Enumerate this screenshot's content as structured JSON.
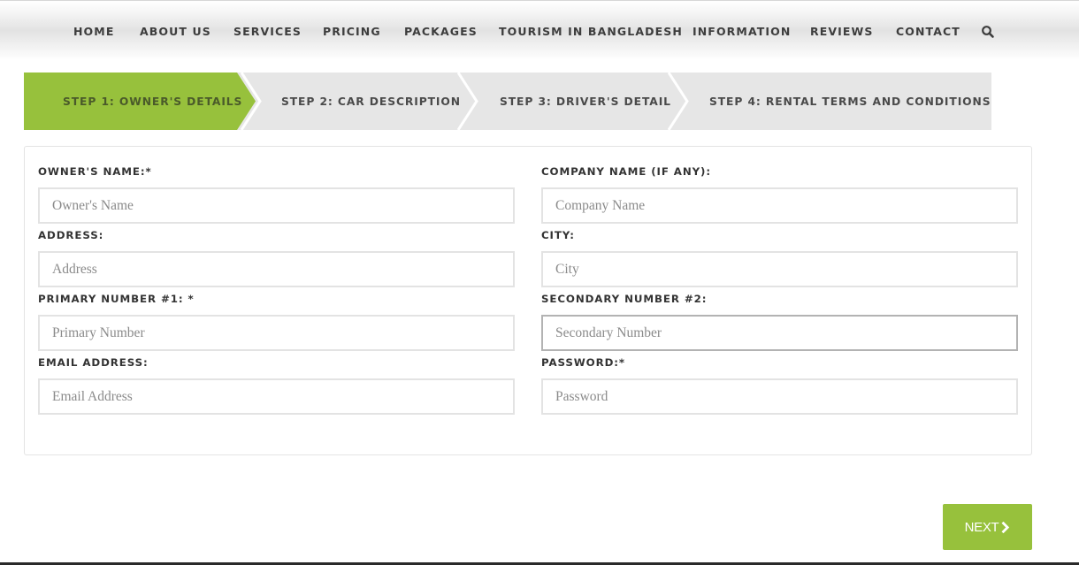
{
  "nav": {
    "items": [
      {
        "label": "HOME"
      },
      {
        "label": "ABOUT US"
      },
      {
        "label": "SERVICES"
      },
      {
        "label": "PRICING"
      },
      {
        "label": "PACKAGES"
      },
      {
        "label": "TOURISM IN BANGLADESH"
      },
      {
        "label": "INFORMATION"
      },
      {
        "label": "REVIEWS"
      },
      {
        "label": "CONTACT"
      }
    ],
    "search_icon": "search-icon"
  },
  "steps": {
    "active_index": 0,
    "active_color": "#97c13c",
    "inactive_color": "#e6e6e6",
    "items": [
      {
        "label": "STEP 1: OWNER'S DETAILS"
      },
      {
        "label": "STEP 2: CAR DESCRIPTION"
      },
      {
        "label": "STEP 3: DRIVER'S DETAIL"
      },
      {
        "label": "STEP 4: RENTAL TERMS AND CONDITIONS"
      }
    ]
  },
  "form": {
    "owner_name": {
      "label": "OWNER'S NAME:*",
      "placeholder": "Owner's Name",
      "value": ""
    },
    "company_name": {
      "label": "COMPANY NAME (IF ANY):",
      "placeholder": "Company Name",
      "value": ""
    },
    "address": {
      "label": "ADDRESS:",
      "placeholder": "Address",
      "value": ""
    },
    "city": {
      "label": "CITY:",
      "placeholder": "City",
      "value": ""
    },
    "primary_number": {
      "label": "PRIMARY NUMBER #1: *",
      "placeholder": "Primary Number",
      "value": ""
    },
    "secondary_number": {
      "label": "SECONDARY NUMBER #2:",
      "placeholder": "Secondary Number",
      "value": "",
      "focused": true
    },
    "email": {
      "label": "EMAIL ADDRESS:",
      "placeholder": "Email Address",
      "value": ""
    },
    "password": {
      "label": "PASSWORD:*",
      "placeholder": "Password",
      "value": ""
    }
  },
  "next_button": {
    "label": "NEXT",
    "icon": "chevron-right-icon",
    "color": "#97c13c"
  }
}
